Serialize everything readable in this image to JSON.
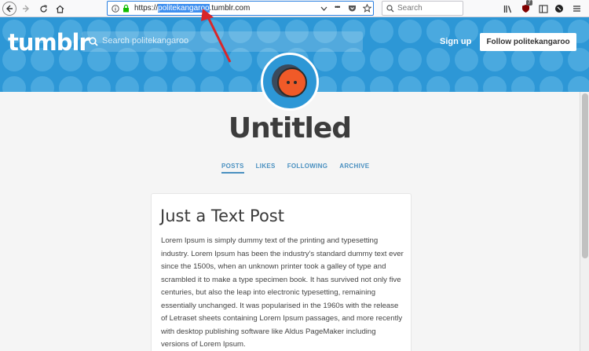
{
  "browser": {
    "url_prefix": "https://",
    "url_highlight": "politekangaroo",
    "url_suffix": ".tumblr.com",
    "search_placeholder": "Search",
    "more_dots": "•••",
    "bookmarks_icon": "library-icon",
    "ext_badge": "7"
  },
  "header": {
    "logo": "tumblr",
    "search_placeholder": "Search politekangaroo",
    "signup": "Sign up",
    "follow": "Follow politekangaroo",
    "color": "#2d97d6"
  },
  "blog": {
    "title": "Untitled",
    "nav": [
      "POSTS",
      "LIKES",
      "FOLLOWING",
      "ARCHIVE"
    ],
    "active_tab": "POSTS"
  },
  "post": {
    "title": "Just a Text Post",
    "body": "Lorem Ipsum is simply dummy text of the printing and typesetting industry. Lorem Ipsum has been the industry's standard dummy text ever since the 1500s, when an unknown printer took a galley of type and scrambled it to make a type specimen book. It has survived not only five centuries, but also the leap into electronic typesetting, remaining essentially unchanged. It was popularised in the 1960s with the release of Letraset sheets containing Lorem Ipsum passages, and more recently with desktop publishing software like Aldus PageMaker including versions of Lorem Ipsum."
  },
  "colors": {
    "annotation_arrow": "#d9262a",
    "avatar_face": "#f05a28",
    "avatar_bg": "#3a4a5c"
  }
}
